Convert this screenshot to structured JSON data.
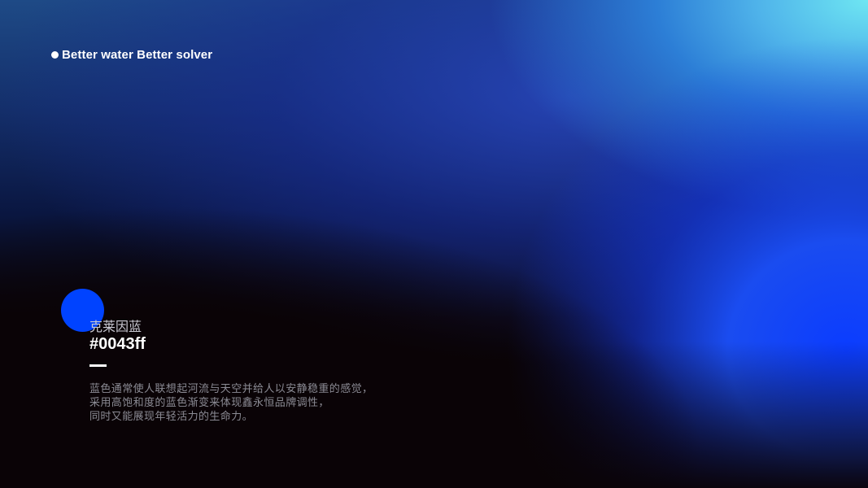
{
  "tagline": {
    "text": "Better water Better solver"
  },
  "color": {
    "name": "克莱因蓝",
    "hex": "#0043ff"
  },
  "description": {
    "lines": [
      "蓝色通常使人联想起河流与天空并给人以安静稳重的感觉，",
      "采用高饱和度的蓝色渐变来体现鑫永恒品牌调性，",
      "同时又能展现年轻活力的生命力。"
    ]
  },
  "colors": {
    "accent": "#0043ff",
    "text_primary": "#ffffff",
    "text_secondary": "#8b8b94"
  }
}
